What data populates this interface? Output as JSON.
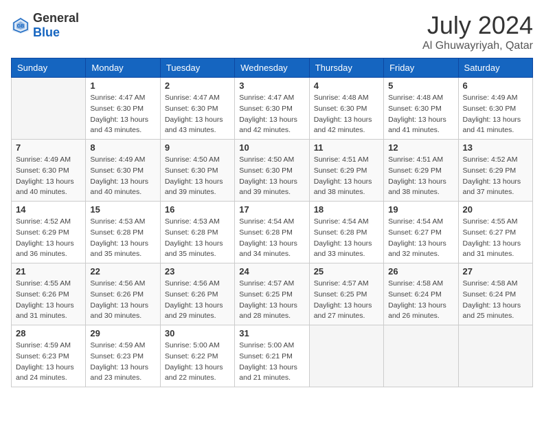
{
  "header": {
    "logo_general": "General",
    "logo_blue": "Blue",
    "month_title": "July 2024",
    "location": "Al Ghuwayriyah, Qatar"
  },
  "days_of_week": [
    "Sunday",
    "Monday",
    "Tuesday",
    "Wednesday",
    "Thursday",
    "Friday",
    "Saturday"
  ],
  "weeks": [
    [
      {
        "day": "",
        "sunrise": "",
        "sunset": "",
        "daylight": ""
      },
      {
        "day": "1",
        "sunrise": "Sunrise: 4:47 AM",
        "sunset": "Sunset: 6:30 PM",
        "daylight": "Daylight: 13 hours and 43 minutes."
      },
      {
        "day": "2",
        "sunrise": "Sunrise: 4:47 AM",
        "sunset": "Sunset: 6:30 PM",
        "daylight": "Daylight: 13 hours and 43 minutes."
      },
      {
        "day": "3",
        "sunrise": "Sunrise: 4:47 AM",
        "sunset": "Sunset: 6:30 PM",
        "daylight": "Daylight: 13 hours and 42 minutes."
      },
      {
        "day": "4",
        "sunrise": "Sunrise: 4:48 AM",
        "sunset": "Sunset: 6:30 PM",
        "daylight": "Daylight: 13 hours and 42 minutes."
      },
      {
        "day": "5",
        "sunrise": "Sunrise: 4:48 AM",
        "sunset": "Sunset: 6:30 PM",
        "daylight": "Daylight: 13 hours and 41 minutes."
      },
      {
        "day": "6",
        "sunrise": "Sunrise: 4:49 AM",
        "sunset": "Sunset: 6:30 PM",
        "daylight": "Daylight: 13 hours and 41 minutes."
      }
    ],
    [
      {
        "day": "7",
        "sunrise": "Sunrise: 4:49 AM",
        "sunset": "Sunset: 6:30 PM",
        "daylight": "Daylight: 13 hours and 40 minutes."
      },
      {
        "day": "8",
        "sunrise": "Sunrise: 4:49 AM",
        "sunset": "Sunset: 6:30 PM",
        "daylight": "Daylight: 13 hours and 40 minutes."
      },
      {
        "day": "9",
        "sunrise": "Sunrise: 4:50 AM",
        "sunset": "Sunset: 6:30 PM",
        "daylight": "Daylight: 13 hours and 39 minutes."
      },
      {
        "day": "10",
        "sunrise": "Sunrise: 4:50 AM",
        "sunset": "Sunset: 6:30 PM",
        "daylight": "Daylight: 13 hours and 39 minutes."
      },
      {
        "day": "11",
        "sunrise": "Sunrise: 4:51 AM",
        "sunset": "Sunset: 6:29 PM",
        "daylight": "Daylight: 13 hours and 38 minutes."
      },
      {
        "day": "12",
        "sunrise": "Sunrise: 4:51 AM",
        "sunset": "Sunset: 6:29 PM",
        "daylight": "Daylight: 13 hours and 38 minutes."
      },
      {
        "day": "13",
        "sunrise": "Sunrise: 4:52 AM",
        "sunset": "Sunset: 6:29 PM",
        "daylight": "Daylight: 13 hours and 37 minutes."
      }
    ],
    [
      {
        "day": "14",
        "sunrise": "Sunrise: 4:52 AM",
        "sunset": "Sunset: 6:29 PM",
        "daylight": "Daylight: 13 hours and 36 minutes."
      },
      {
        "day": "15",
        "sunrise": "Sunrise: 4:53 AM",
        "sunset": "Sunset: 6:28 PM",
        "daylight": "Daylight: 13 hours and 35 minutes."
      },
      {
        "day": "16",
        "sunrise": "Sunrise: 4:53 AM",
        "sunset": "Sunset: 6:28 PM",
        "daylight": "Daylight: 13 hours and 35 minutes."
      },
      {
        "day": "17",
        "sunrise": "Sunrise: 4:54 AM",
        "sunset": "Sunset: 6:28 PM",
        "daylight": "Daylight: 13 hours and 34 minutes."
      },
      {
        "day": "18",
        "sunrise": "Sunrise: 4:54 AM",
        "sunset": "Sunset: 6:28 PM",
        "daylight": "Daylight: 13 hours and 33 minutes."
      },
      {
        "day": "19",
        "sunrise": "Sunrise: 4:54 AM",
        "sunset": "Sunset: 6:27 PM",
        "daylight": "Daylight: 13 hours and 32 minutes."
      },
      {
        "day": "20",
        "sunrise": "Sunrise: 4:55 AM",
        "sunset": "Sunset: 6:27 PM",
        "daylight": "Daylight: 13 hours and 31 minutes."
      }
    ],
    [
      {
        "day": "21",
        "sunrise": "Sunrise: 4:55 AM",
        "sunset": "Sunset: 6:26 PM",
        "daylight": "Daylight: 13 hours and 31 minutes."
      },
      {
        "day": "22",
        "sunrise": "Sunrise: 4:56 AM",
        "sunset": "Sunset: 6:26 PM",
        "daylight": "Daylight: 13 hours and 30 minutes."
      },
      {
        "day": "23",
        "sunrise": "Sunrise: 4:56 AM",
        "sunset": "Sunset: 6:26 PM",
        "daylight": "Daylight: 13 hours and 29 minutes."
      },
      {
        "day": "24",
        "sunrise": "Sunrise: 4:57 AM",
        "sunset": "Sunset: 6:25 PM",
        "daylight": "Daylight: 13 hours and 28 minutes."
      },
      {
        "day": "25",
        "sunrise": "Sunrise: 4:57 AM",
        "sunset": "Sunset: 6:25 PM",
        "daylight": "Daylight: 13 hours and 27 minutes."
      },
      {
        "day": "26",
        "sunrise": "Sunrise: 4:58 AM",
        "sunset": "Sunset: 6:24 PM",
        "daylight": "Daylight: 13 hours and 26 minutes."
      },
      {
        "day": "27",
        "sunrise": "Sunrise: 4:58 AM",
        "sunset": "Sunset: 6:24 PM",
        "daylight": "Daylight: 13 hours and 25 minutes."
      }
    ],
    [
      {
        "day": "28",
        "sunrise": "Sunrise: 4:59 AM",
        "sunset": "Sunset: 6:23 PM",
        "daylight": "Daylight: 13 hours and 24 minutes."
      },
      {
        "day": "29",
        "sunrise": "Sunrise: 4:59 AM",
        "sunset": "Sunset: 6:23 PM",
        "daylight": "Daylight: 13 hours and 23 minutes."
      },
      {
        "day": "30",
        "sunrise": "Sunrise: 5:00 AM",
        "sunset": "Sunset: 6:22 PM",
        "daylight": "Daylight: 13 hours and 22 minutes."
      },
      {
        "day": "31",
        "sunrise": "Sunrise: 5:00 AM",
        "sunset": "Sunset: 6:21 PM",
        "daylight": "Daylight: 13 hours and 21 minutes."
      },
      {
        "day": "",
        "sunrise": "",
        "sunset": "",
        "daylight": ""
      },
      {
        "day": "",
        "sunrise": "",
        "sunset": "",
        "daylight": ""
      },
      {
        "day": "",
        "sunrise": "",
        "sunset": "",
        "daylight": ""
      }
    ]
  ]
}
